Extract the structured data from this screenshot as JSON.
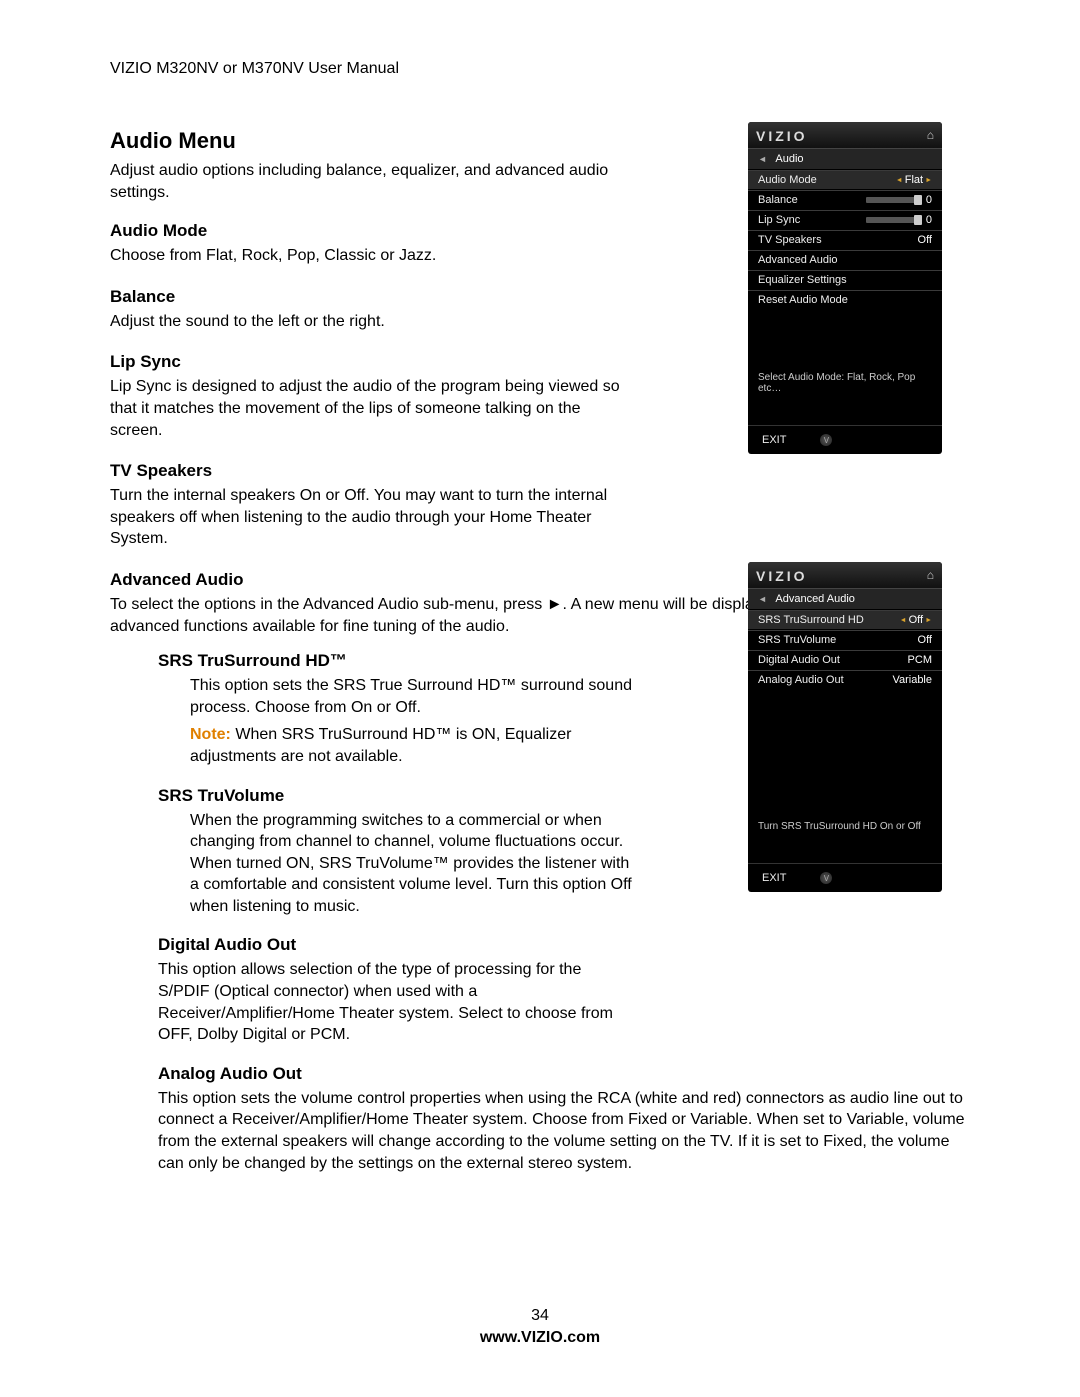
{
  "header": "VIZIO M320NV or M370NV User Manual",
  "section": {
    "title": "Audio Menu",
    "desc": "Adjust audio options including balance, equalizer, and advanced audio settings."
  },
  "audio_mode": {
    "heading": "Audio Mode",
    "desc": "Choose from Flat, Rock, Pop, Classic or Jazz."
  },
  "balance": {
    "heading": "Balance",
    "desc": "Adjust the sound to the left or the right."
  },
  "lip_sync": {
    "heading": "Lip Sync",
    "desc": "Lip Sync is designed to adjust the audio of the program being viewed so that it matches the movement of the lips of someone talking on the screen."
  },
  "tv_speakers": {
    "heading": "TV Speakers",
    "desc": "Turn the internal speakers On or Off. You may want to turn the internal speakers off when listening to the audio through your Home Theater System."
  },
  "advanced_audio": {
    "heading": "Advanced Audio",
    "desc": "To select the options in the Advanced Audio sub-menu, press ►. A new menu will be displayed showing the advanced functions available for fine tuning of the audio."
  },
  "srs_tsh": {
    "heading": "SRS TruSurround HD™",
    "desc": "This option sets the SRS True Surround HD™ surround sound process. Choose from On or Off.",
    "note_label": "Note:",
    "note_text": " When SRS TruSurround HD™ is ON, Equalizer adjustments are not available."
  },
  "srs_tv": {
    "heading": "SRS TruVolume",
    "desc": "When the programming switches to a commercial or when changing from channel to channel, volume fluctuations occur. When turned ON, SRS TruVolume™ provides the listener with a comfortable and consistent volume level. Turn this option Off when listening to music."
  },
  "digital_out": {
    "heading": "Digital Audio Out",
    "desc": "This option allows selection of the type of processing for the S/PDIF (Optical connector) when used with a Receiver/Amplifier/Home Theater system. Select to choose from OFF, Dolby Digital or PCM."
  },
  "analog_out": {
    "heading": "Analog Audio Out",
    "desc": "This option sets the volume control properties when using the RCA (white and red) connectors as audio line out to connect a Receiver/Amplifier/Home Theater system. Choose from Fixed or Variable. When set to Variable, volume from the external speakers will change according to the volume setting on the TV. If it is set to Fixed, the volume can only be changed by the settings on the external stereo system."
  },
  "footer": {
    "page": "34",
    "site": "www.VIZIO.com"
  },
  "osd1": {
    "brand": "VIZIO",
    "crumb": "Audio",
    "rows": {
      "r1": {
        "label": "Audio Mode",
        "value": "Flat"
      },
      "r2": {
        "label": "Balance",
        "value": "0"
      },
      "r3": {
        "label": "Lip Sync",
        "value": "0"
      },
      "r4": {
        "label": "TV Speakers",
        "value": "Off"
      },
      "r5": {
        "label": "Advanced Audio"
      },
      "r6": {
        "label": "Equalizer Settings"
      },
      "r7": {
        "label": "Reset Audio Mode"
      }
    },
    "hint": "Select Audio Mode: Flat, Rock, Pop etc…",
    "exit": "EXIT"
  },
  "osd2": {
    "brand": "VIZIO",
    "crumb": "Advanced Audio",
    "rows": {
      "r1": {
        "label": "SRS TruSurround HD",
        "value": "Off"
      },
      "r2": {
        "label": "SRS TruVolume",
        "value": "Off"
      },
      "r3": {
        "label": "Digital Audio Out",
        "value": "PCM"
      },
      "r4": {
        "label": "Analog Audio Out",
        "value": "Variable"
      }
    },
    "hint": "Turn SRS TruSurround HD On or Off",
    "exit": "EXIT"
  }
}
